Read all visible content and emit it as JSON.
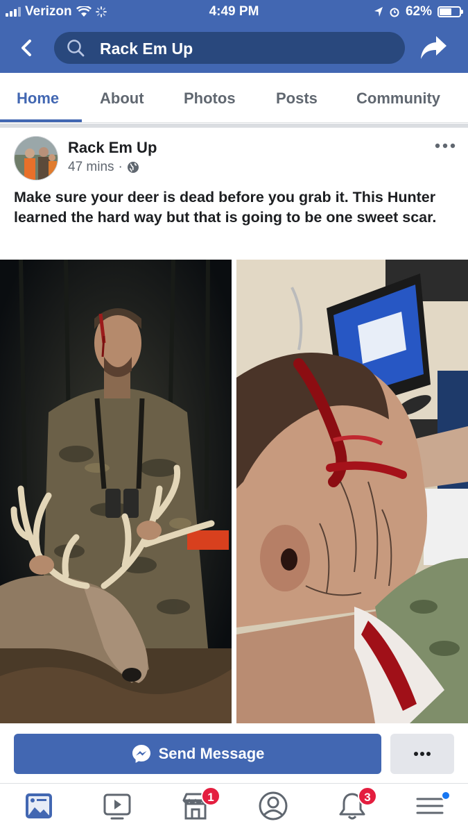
{
  "status_bar": {
    "carrier": "Verizon",
    "time": "4:49 PM",
    "battery_percent": "62%",
    "battery_level": 0.62
  },
  "nav": {
    "search_text": "Rack Em Up",
    "icons": [
      "chevron-left-icon",
      "search-icon",
      "share-icon"
    ]
  },
  "tabs": [
    {
      "label": "Home",
      "active": true
    },
    {
      "label": "About",
      "active": false
    },
    {
      "label": "Photos",
      "active": false
    },
    {
      "label": "Posts",
      "active": false
    },
    {
      "label": "Community",
      "active": false
    }
  ],
  "post": {
    "author": "Rack Em Up",
    "time_ago": "47 mins",
    "separator": "·",
    "privacy_icon": "globe-icon",
    "text": "Make sure your deer is dead before you grab it. This Hunter learned the hard way but that is going to be one sweet scar.",
    "photos": [
      "hunter-with-deer-photo",
      "head-wound-photo"
    ]
  },
  "actions": {
    "send_message_label": "Send Message",
    "more_label": "•••"
  },
  "bottom_nav": {
    "items": [
      {
        "name": "news-feed-icon",
        "badge": ""
      },
      {
        "name": "watch-icon",
        "badge": ""
      },
      {
        "name": "marketplace-icon",
        "badge": "1"
      },
      {
        "name": "profile-icon",
        "badge": ""
      },
      {
        "name": "notifications-icon",
        "badge": "3"
      },
      {
        "name": "menu-icon",
        "badge": ""
      }
    ]
  },
  "colors": {
    "brand": "#4267b2",
    "badge": "#e41e3f"
  }
}
